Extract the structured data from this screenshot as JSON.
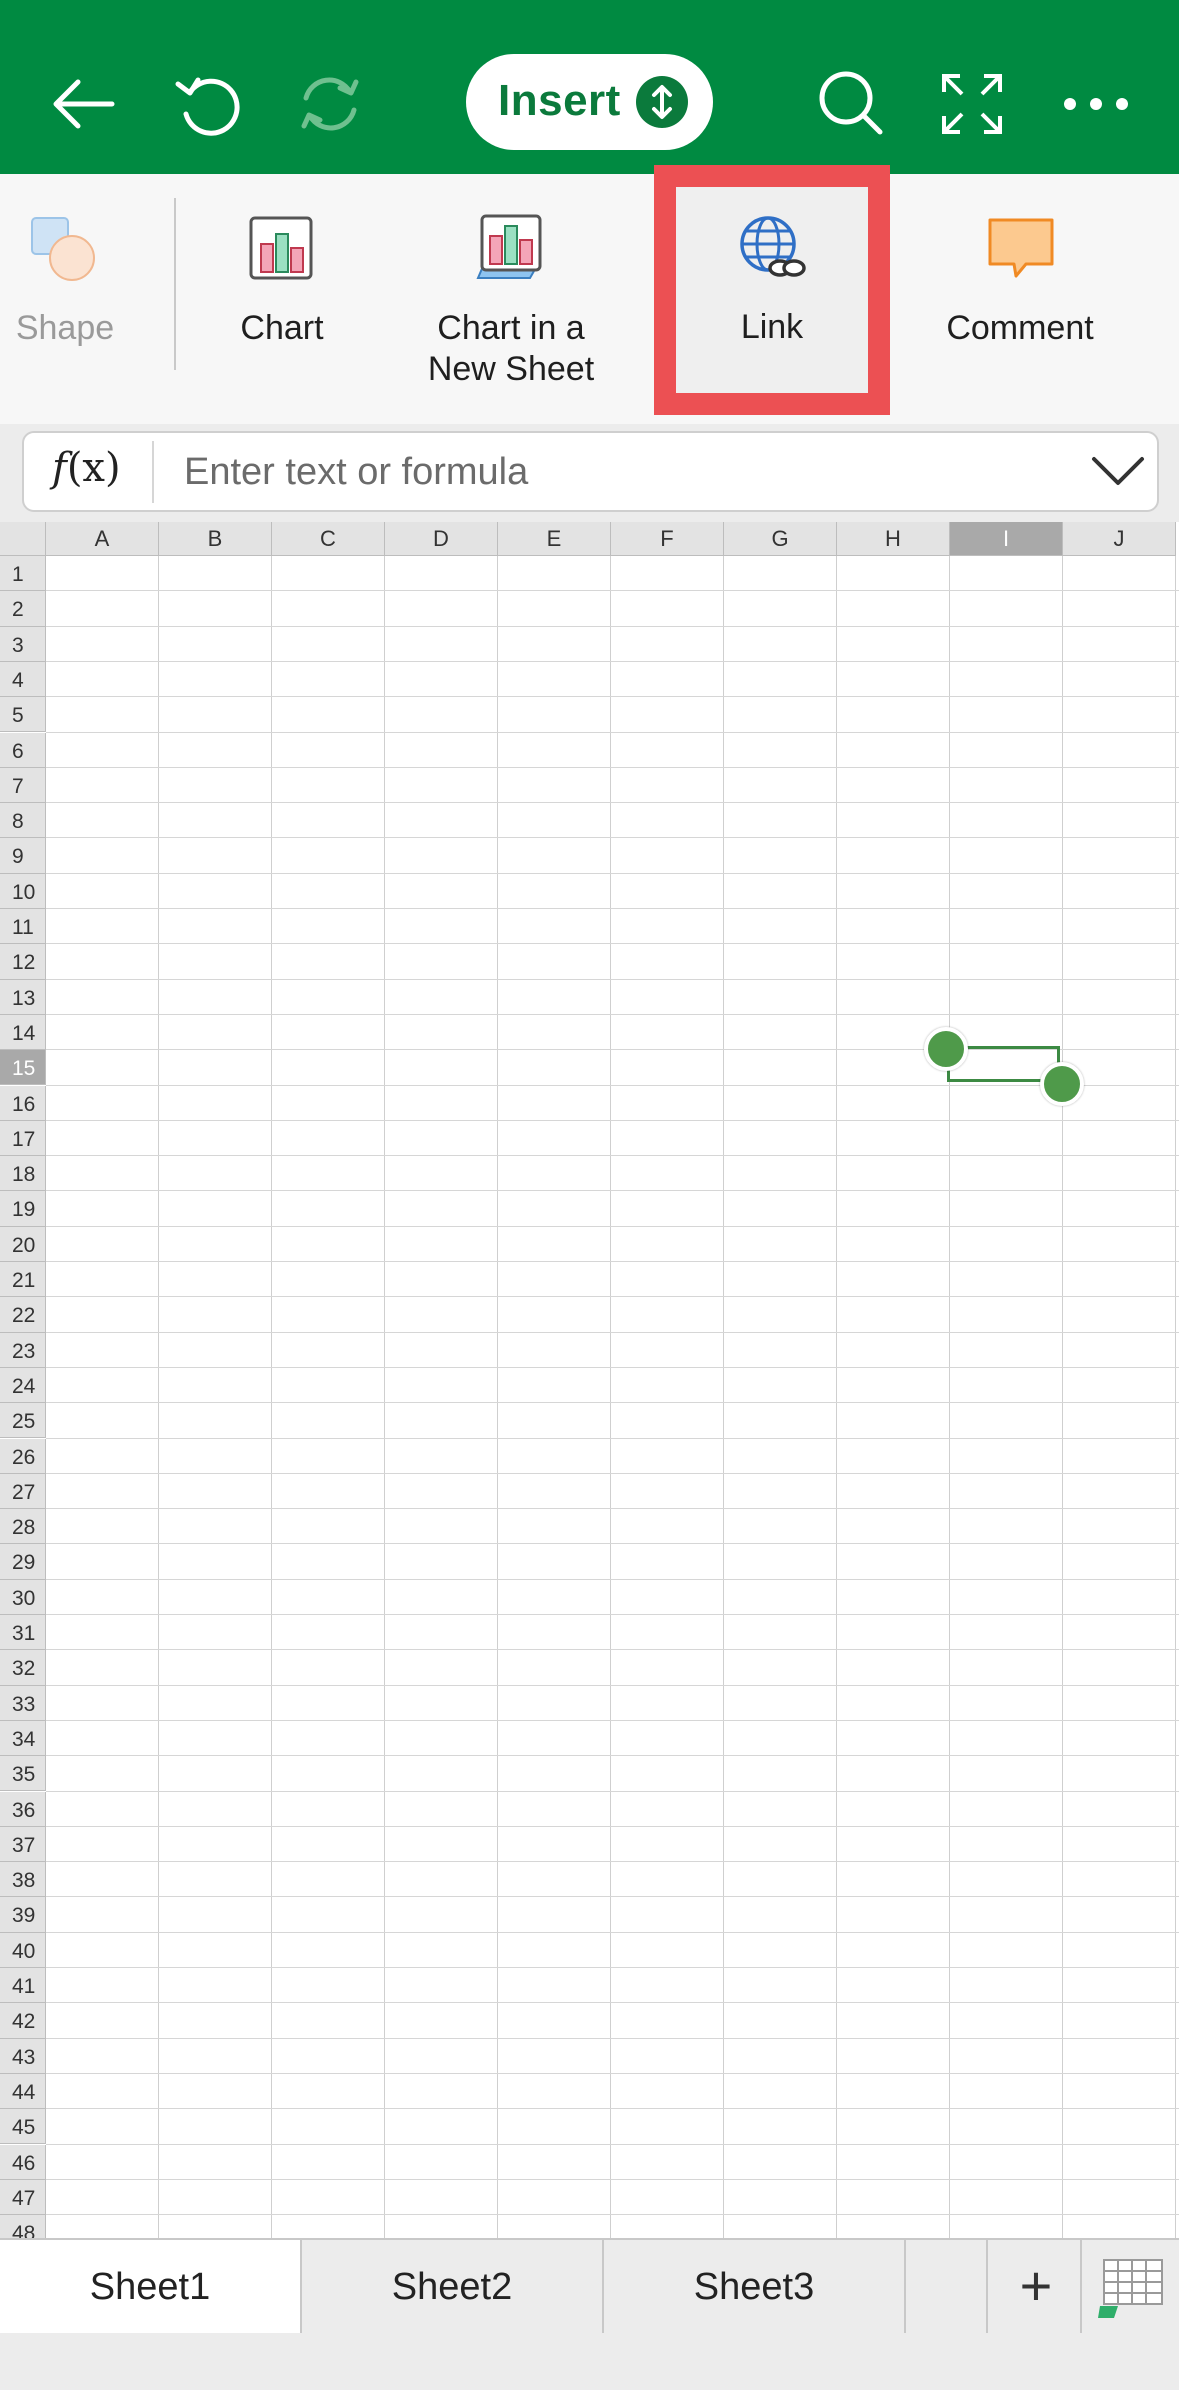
{
  "toolbar": {
    "insert_label": "Insert",
    "icons": [
      "back-arrow-icon",
      "undo-icon",
      "redo-icon",
      "search-icon",
      "fullscreen-icon",
      "more-icon"
    ],
    "accent": "#008a41"
  },
  "ribbon": {
    "items": [
      {
        "label": "Shape",
        "icon": "shape-icon"
      },
      {
        "label": "Chart",
        "icon": "chart-icon"
      },
      {
        "label": "Chart in a\nNew Sheet",
        "label_line1": "Chart in a",
        "label_line2": "New Sheet",
        "icon": "chart-new-sheet-icon"
      },
      {
        "label": "Link",
        "icon": "link-globe-icon",
        "highlighted": true
      },
      {
        "label": "Comment",
        "icon": "comment-icon"
      }
    ],
    "highlight_color": "#ec5053"
  },
  "formula_bar": {
    "fx_label": "f(x)",
    "placeholder": "Enter text or formula",
    "value": ""
  },
  "grid": {
    "columns": [
      "A",
      "B",
      "C",
      "D",
      "E",
      "F",
      "G",
      "H",
      "I",
      "J"
    ],
    "rows": [
      "1",
      "2",
      "3",
      "4",
      "5",
      "6",
      "7",
      "8",
      "9",
      "10",
      "11",
      "12",
      "13",
      "14",
      "15",
      "16",
      "17",
      "18",
      "19",
      "20",
      "21",
      "22",
      "23",
      "24",
      "25",
      "26",
      "27",
      "28",
      "29",
      "30",
      "31",
      "32",
      "33",
      "34",
      "35",
      "36",
      "37",
      "38",
      "39",
      "40",
      "41",
      "42",
      "43",
      "44",
      "45",
      "46",
      "47",
      "48"
    ],
    "selected_column": "I",
    "selected_row": "15",
    "selection_color": "#4f9a4a"
  },
  "sheets": {
    "tabs": [
      "Sheet1",
      "Sheet2",
      "Sheet3"
    ],
    "active": "Sheet1",
    "add_label": "+"
  }
}
